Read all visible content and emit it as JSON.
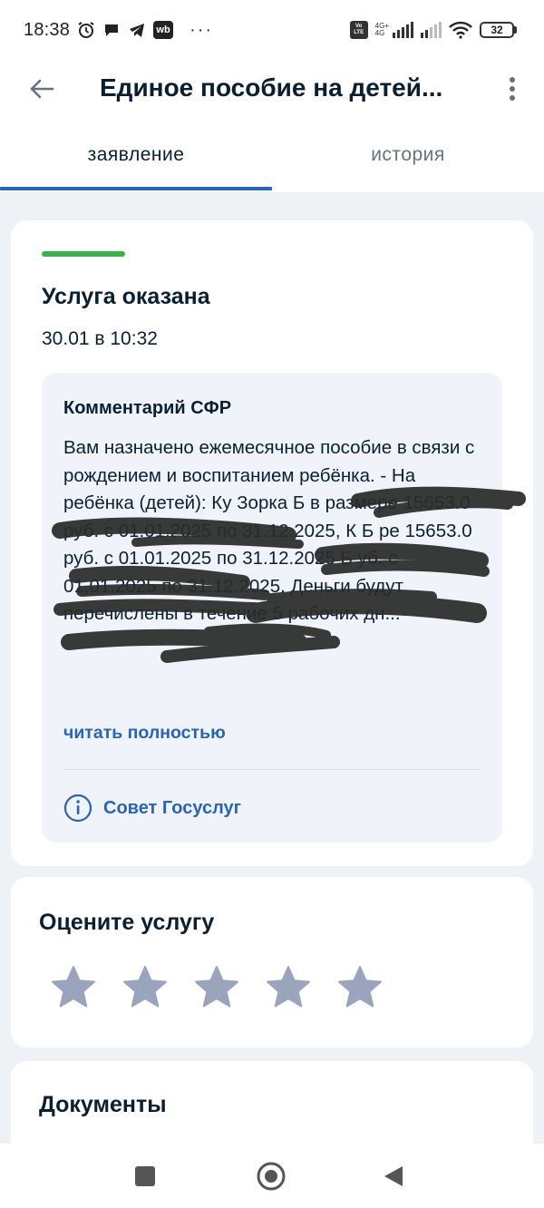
{
  "status_bar": {
    "time": "18:38",
    "dots": "···",
    "volte_line1": "Vo",
    "volte_line2": "LTE",
    "network_top": "4G+",
    "network_bottom": "4G",
    "battery": "32",
    "wb_label": "wb"
  },
  "header": {
    "title": "Единое пособие на детей..."
  },
  "tabs": [
    {
      "label": "заявление",
      "active": true
    },
    {
      "label": "история",
      "active": false
    }
  ],
  "status_card": {
    "accent_color": "#3ab24a",
    "title": "Услуга оказана",
    "date": "30.01 в 10:32",
    "comment": {
      "title": "Комментарий СФР",
      "text": "Вам назначено ежемесячное пособие в связи с рождением и воспитанием ребёнка. - На ребёнка (детей): Ку Зорка Б в размере 15653.0 руб. с 01.01.2025 по 31.12.2025, К Б ре 15653.0 руб. с 01.01.2025 по 31.12.2025 Б уб. с 01.01.2025 по 31.12.2025. Деньги будут перечислены в течение 5 рабочих дн...",
      "read_more": "читать полностью",
      "advice": "Совет Госуслуг"
    }
  },
  "rating_card": {
    "title": "Оцените услугу",
    "max_stars": 5,
    "filled_stars": 0,
    "star_color": "#9aa5bd"
  },
  "documents_card": {
    "title": "Документы"
  },
  "colors": {
    "primary": "#2a64b2",
    "text": "#0b1f33",
    "background": "#eef1f6"
  }
}
